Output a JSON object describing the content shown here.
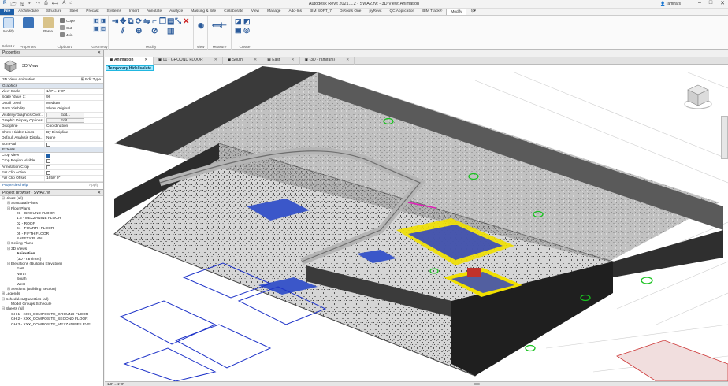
{
  "app": {
    "window_title": "Autodesk Revit 2021.1.2 - SWA2.rvt - 3D View: Animation",
    "user": "ramirars",
    "window_controls": [
      "–",
      "□",
      "✕"
    ]
  },
  "ribbon_tabs": [
    "File",
    "Architecture",
    "Structure",
    "Steel",
    "Precast",
    "Systems",
    "Insert",
    "Annotate",
    "Analyze",
    "Massing & Site",
    "Collaborate",
    "View",
    "Manage",
    "Add-Ins",
    "BIM SOFT_7",
    "DiRoots One",
    "pyRevit",
    "QC Application",
    "BIM Track®",
    "Modify",
    "⊙▾"
  ],
  "active_ribbon_tab": "Modify",
  "ribbon": {
    "select": {
      "modify_label": "Modify",
      "select_label": "Select ▾"
    },
    "properties_label": "Properties",
    "clipboard": {
      "paste_label": "Paste",
      "cope_label": "Cope",
      "cut_label": "Cut",
      "join_label": "Join",
      "panel_label": "Clipboard"
    },
    "geometry_label": "Geometry",
    "modify_label": "Modify",
    "view_label": "View",
    "measure_label": "Measure",
    "create_label": "Create"
  },
  "properties": {
    "header": "Properties",
    "type_name": "3D View",
    "filter": "3D View: Animation",
    "edit_type": "Edit Type",
    "section_graphics": "Graphics",
    "rows_graphics": [
      {
        "k": "View Scale",
        "v": "1/8\" = 1'-0\""
      },
      {
        "k": "Scale Value   1:",
        "v": "96"
      },
      {
        "k": "Detail Level",
        "v": "Medium"
      },
      {
        "k": "Parts Visibility",
        "v": "Show Original"
      },
      {
        "k": "Visibility/Graphics Over...",
        "btn": "Edit..."
      },
      {
        "k": "Graphic Display Options",
        "btn": "Edit..."
      },
      {
        "k": "Discipline",
        "v": "Coordination"
      },
      {
        "k": "Show Hidden Lines",
        "v": "By Discipline"
      },
      {
        "k": "Default Analysis Displa...",
        "v": "None"
      },
      {
        "k": "Sun Path",
        "cb": false
      }
    ],
    "section_extents": "Extents",
    "rows_extents": [
      {
        "k": "Crop View",
        "cb": true
      },
      {
        "k": "Crop Region Visible",
        "cb": false
      },
      {
        "k": "Annotation Crop",
        "cb": false
      },
      {
        "k": "Far Clip Active",
        "cb": false
      },
      {
        "k": "Far Clip Offset",
        "v": "1650' 0\""
      }
    ],
    "help_link": "Properties help",
    "apply_label": "Apply"
  },
  "project_browser": {
    "header": "Project Browser - SWA2.rvt",
    "items": [
      {
        "label": "Views (all)",
        "indent": 0,
        "tog": "⊟"
      },
      {
        "label": "Structural Plans",
        "indent": 1,
        "tog": "⊞"
      },
      {
        "label": "Floor Plans",
        "indent": 1,
        "tog": "⊟"
      },
      {
        "label": "01 - GROUND FLOOR",
        "indent": 2,
        "tog": ""
      },
      {
        "label": "1.5 - MEZZANINE FLOOR",
        "indent": 2,
        "tog": ""
      },
      {
        "label": "02 - ROOF",
        "indent": 2,
        "tog": ""
      },
      {
        "label": "04 - FOURTH FLOOR",
        "indent": 2,
        "tog": ""
      },
      {
        "label": "05 - FIFTH FLOOR",
        "indent": 2,
        "tog": ""
      },
      {
        "label": "SAFETY PLAN",
        "indent": 2,
        "tog": ""
      },
      {
        "label": "Ceiling Plans",
        "indent": 1,
        "tog": "⊞"
      },
      {
        "label": "3D Views",
        "indent": 1,
        "tog": "⊟"
      },
      {
        "label": "Animation",
        "indent": 2,
        "tog": "",
        "bold": true
      },
      {
        "label": "{3D - ramirars}",
        "indent": 2,
        "tog": ""
      },
      {
        "label": "Elevations (Building Elevation)",
        "indent": 1,
        "tog": "⊟"
      },
      {
        "label": "East",
        "indent": 2,
        "tog": ""
      },
      {
        "label": "North",
        "indent": 2,
        "tog": ""
      },
      {
        "label": "South",
        "indent": 2,
        "tog": ""
      },
      {
        "label": "West",
        "indent": 2,
        "tog": ""
      },
      {
        "label": "Sections (Building Section)",
        "indent": 1,
        "tog": "⊞"
      },
      {
        "label": "Legends",
        "indent": 0,
        "tog": "⊞"
      },
      {
        "label": "Schedules/Quantities (all)",
        "indent": 0,
        "tog": "⊟"
      },
      {
        "label": "Model Groups Schedule",
        "indent": 1,
        "tog": ""
      },
      {
        "label": "Sheets (all)",
        "indent": 0,
        "tog": "⊟"
      },
      {
        "label": "GH 1 - XXX_COMPOSITE_GROUND FLOOR",
        "indent": 1,
        "tog": ""
      },
      {
        "label": "GH 2 - XXX_COMPOSITE_SECOND FLOOR",
        "indent": 1,
        "tog": ""
      },
      {
        "label": "GH 3 - XXX_COMPOSITE_MEZZANINE LEVEL",
        "indent": 1,
        "tog": ""
      }
    ]
  },
  "view_tabs": [
    {
      "label": "Animation",
      "active": true
    },
    {
      "label": "01 - GROUND FLOOR",
      "active": false
    },
    {
      "label": "South",
      "active": false
    },
    {
      "label": "East",
      "active": false
    },
    {
      "label": "{3D - ramirars}",
      "active": false
    }
  ],
  "viewport": {
    "temp_hide_label": "Temporary Hide/Isolate",
    "bottom_scale": "1/8\" = 1'-0\""
  },
  "colors": {
    "file_tab": "#1e5fa8",
    "temp_hide_bg": "#9fe8ff",
    "rack_yellow": "#f1e000",
    "pallet_blue": "#2a3fc8",
    "marker_green": "#19c21f"
  }
}
